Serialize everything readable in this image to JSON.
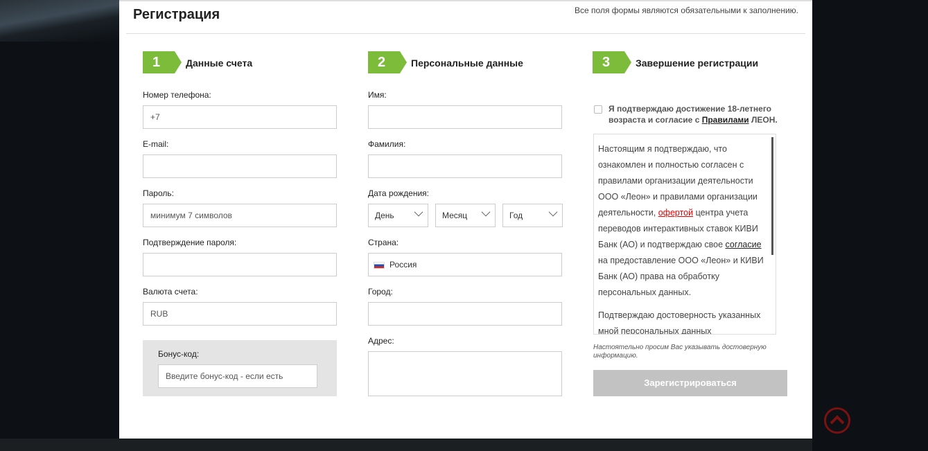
{
  "header": {
    "title": "Регистрация",
    "required_note": "Все поля формы являются обязательными к заполнению."
  },
  "steps": [
    {
      "number": "1",
      "label": "Данные счета"
    },
    {
      "number": "2",
      "label": "Персональные данные"
    },
    {
      "number": "3",
      "label": "Завершение регистрации"
    }
  ],
  "account": {
    "phone_label": "Номер телефона:",
    "phone_value": "+7",
    "email_label": "E-mail:",
    "password_label": "Пароль:",
    "password_placeholder": "минимум 7 символов",
    "confirm_label": "Подтверждение пароля:",
    "currency_label": "Валюта счета:",
    "currency_value": "RUB",
    "bonus_label": "Бонус-код:",
    "bonus_placeholder": "Введите бонус-код - если есть"
  },
  "personal": {
    "name_label": "Имя:",
    "surname_label": "Фамилия:",
    "dob_label": "Дата рождения:",
    "day": "День",
    "month": "Месяц",
    "year": "Год",
    "country_label": "Страна:",
    "country_value": "Россия",
    "city_label": "Город:",
    "address_label": "Адрес:"
  },
  "finish": {
    "agree_pre": "Я подтверждаю достижение 18-летнего возраста и согласие с ",
    "agree_link": "Правилами",
    "agree_post": " ЛЕОН.",
    "terms_p1_a": "Настоящим я подтверждаю, что ознакомлен и полностью согласен с правилами организации деятельности ООО «Леон» и правилами организации деятельности, ",
    "terms_p1_link": "офертой",
    "terms_p1_b": " центра учета переводов интерактивных ставок КИВИ Банк (АО) и подтверждаю свое ",
    "terms_p1_link2": "согласие",
    "terms_p1_c": " на предоставление ООО «Леон» и КИВИ Банк (АО) права на обработку персональных данных.",
    "terms_p2": "Подтверждаю достоверность указанных мной персональных данных",
    "note": "Настоятельно просим Вас указывать достоверную информацию.",
    "register_button": "Зарегистрироваться"
  },
  "colors": {
    "accent": "#7dbb3b",
    "button_disabled": "#c2c2c2",
    "scroll_top": "#7a1212"
  }
}
